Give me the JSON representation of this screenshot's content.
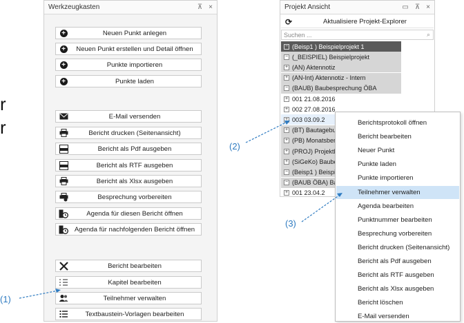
{
  "toolbox": {
    "title": "Werkzeugkasten",
    "pin": "⊼",
    "close": "×",
    "buttons": [
      {
        "label": "Neuen Punkt anlegen",
        "icon": "plus-circle-icon"
      },
      {
        "label": "Neuen Punkt erstellen und Detail öffnen",
        "icon": "plus-circle-icon"
      },
      {
        "label": "Punkte importieren",
        "icon": "plus-circle-icon"
      },
      {
        "label": "Punkte laden",
        "icon": "plus-circle-icon"
      },
      {
        "label": "E-Mail versenden",
        "icon": "envelope-icon"
      },
      {
        "label": "Bericht drucken (Seitenansicht)",
        "icon": "printer-icon"
      },
      {
        "label": "Bericht als Pdf ausgeben",
        "icon": "pdf-icon"
      },
      {
        "label": "Bericht als RTF ausgeben",
        "icon": "rtf-icon"
      },
      {
        "label": "Bericht als Xlsx ausgeben",
        "icon": "printer-icon"
      },
      {
        "label": "Besprechung vorbereiten",
        "icon": "printer-gear-icon"
      },
      {
        "label": "Agenda für diesen Bericht öffnen",
        "icon": "agenda-clock-icon"
      },
      {
        "label": "Agenda für nachfolgenden Bericht öffnen",
        "icon": "agenda-clock-icon"
      },
      {
        "label": "Bericht bearbeiten",
        "icon": "tools-icon"
      },
      {
        "label": "Kapitel bearbeiten",
        "icon": "numbered-list-icon"
      },
      {
        "label": "Teilnehmer verwalten",
        "icon": "people-icon"
      },
      {
        "label": "Textbaustein-Vorlagen bearbeiten",
        "icon": "list-icon"
      }
    ]
  },
  "project": {
    "title": "Projekt Ansicht",
    "refresh_label": "Aktualisiere Projekt-Explorer",
    "search_placeholder": "Suchen ...",
    "rows": [
      {
        "text": "(Beisp1 ) Beispielprojekt 1",
        "style": "dark",
        "exp": "−"
      },
      {
        "text": "(_BEISPIEL) Beispielprojekt",
        "style": "grp",
        "exp": "−"
      },
      {
        "text": "(AN) Aktennotiz",
        "style": "grp",
        "exp": "+"
      },
      {
        "text": "(AN-Int) Aktennotiz - Intern",
        "style": "grp",
        "exp": "+"
      },
      {
        "text": "(BAUB) Baubesprechung ÖBA",
        "style": "grp",
        "exp": "−"
      },
      {
        "text": "001  21.08.2016",
        "style": "",
        "exp": "+"
      },
      {
        "text": "002  27.08.2016",
        "style": "",
        "exp": "+"
      },
      {
        "text": "003  03.09.2",
        "style": "",
        "exp": "+"
      },
      {
        "text": "(BT) Bautagebu",
        "style": "grp",
        "exp": "+"
      },
      {
        "text": "(PB) Monatsber",
        "style": "grp",
        "exp": "+"
      },
      {
        "text": "(PROJ) Projektl",
        "style": "grp",
        "exp": "+"
      },
      {
        "text": "(SiGeKo) Baube",
        "style": "grp",
        "exp": "+"
      },
      {
        "text": "(Beisp1 ) Beispie",
        "style": "grp",
        "exp": "−"
      },
      {
        "text": "(BAUB ÖBA) Ba",
        "style": "grp",
        "exp": "−"
      },
      {
        "text": "001  23.04.2",
        "style": "",
        "exp": "+"
      }
    ]
  },
  "context_menu": {
    "items": [
      "Berichtsprotokoll öffnen",
      "Bericht bearbeiten",
      "Neuer Punkt",
      "Punkte laden",
      "Punkte importieren",
      "Teilnehmer verwalten",
      "Agenda bearbeiten",
      "Punktnummer bearbeiten",
      "Besprechung vorbereiten",
      "Bericht drucken (Seitenansicht)",
      "Bericht als Pdf ausgeben",
      "Bericht als RTF ausgeben",
      "Bericht als Xlsx ausgeben",
      "Bericht löschen",
      "E-Mail versenden"
    ],
    "selected": "Teilnehmer verwalten"
  },
  "callouts": {
    "c1": "(1)",
    "c2": "(2)",
    "c3": "(3)"
  },
  "background_letters": {
    "a": "r",
    "b": "r"
  },
  "colors": {
    "callout": "#2e7bc1",
    "selection": "#cfe4f7",
    "tree_dark": "#5a5a5a"
  }
}
